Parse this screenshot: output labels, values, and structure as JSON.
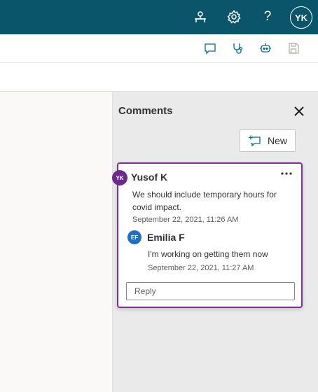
{
  "topbar": {
    "background": "#0b556a",
    "icons": [
      "agent-icon",
      "gear-icon",
      "help-icon"
    ],
    "help_glyph": "?",
    "user_initials": "YK"
  },
  "command_bar": {
    "icons": [
      "comment-icon",
      "stethoscope-icon",
      "bot-icon",
      "save-icon"
    ]
  },
  "comments": {
    "title": "Comments",
    "new_label": "New",
    "thread": {
      "author_initials": "YK",
      "author": "Yusof K",
      "message": "We should include temporary hours for covid impact.",
      "timestamp": "September 22, 2021, 11:26 AM",
      "accent": "#7b3196",
      "reply": {
        "author_initials": "EF",
        "author": "Emilia F",
        "message": "I'm working on getting them now",
        "timestamp": "September 22, 2021, 11:27 AM"
      },
      "reply_placeholder": "Reply"
    }
  }
}
